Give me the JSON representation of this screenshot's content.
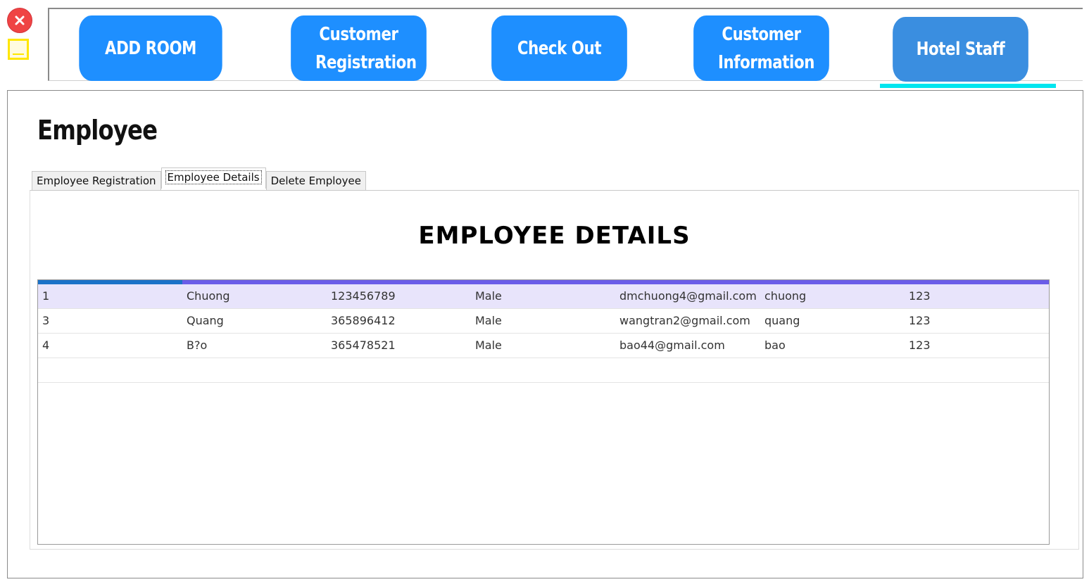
{
  "window": {
    "close_icon": "close-x-icon",
    "minimize_icon": "minimize-icon"
  },
  "nav": {
    "items": [
      {
        "label": "ADD ROOM"
      },
      {
        "label": "Customer Registration"
      },
      {
        "label": "Check Out"
      },
      {
        "label": "Customer Information"
      },
      {
        "label": "Hotel Staff",
        "active": true
      }
    ]
  },
  "page": {
    "title": "Employee"
  },
  "tabs": [
    {
      "label": "Employee Registration"
    },
    {
      "label": "Employee Details",
      "selected": true
    },
    {
      "label": "Delete Employee"
    }
  ],
  "details": {
    "heading": "EMPLOYEE DETAILS"
  },
  "table": {
    "rows": [
      [
        "1",
        "Chuong",
        "123456789",
        "Male",
        "dmchuong4@gmail.com",
        "chuong",
        "123"
      ],
      [
        "3",
        "Quang",
        "365896412",
        "Male",
        "wangtran2@gmail.com",
        "quang",
        "123"
      ],
      [
        "4",
        "B?o",
        "365478521",
        "Male",
        "bao44@gmail.com",
        "bao",
        "123"
      ]
    ]
  },
  "colors": {
    "nav_button": "#1e8fff",
    "nav_button_active": "#3a8ee0",
    "active_underline": "#00e5ef",
    "grid_header": "#6a5ce8",
    "grid_header_first": "#1a72c8",
    "selected_row": "#e8e4fb",
    "close": "#ef4444",
    "minimize": "#ffe600"
  }
}
